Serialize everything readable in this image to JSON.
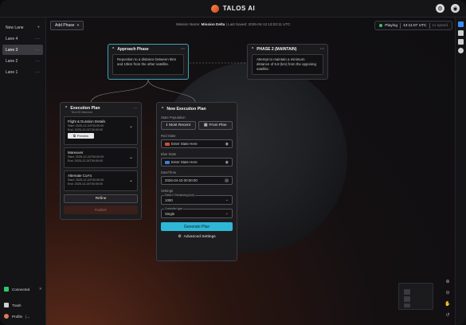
{
  "app": {
    "title": "TALOS AI"
  },
  "sidebar": {
    "new_lane": "New Lane",
    "new_lane_action": "+",
    "lanes": [
      {
        "label": "Lane 4",
        "action": "···"
      },
      {
        "label": "Lane 3",
        "action": "···"
      },
      {
        "label": "Lane 2",
        "action": "···"
      },
      {
        "label": "Lane 1",
        "action": "···"
      }
    ],
    "connected": "Connected",
    "connected_close": "✕",
    "trash": "Trash",
    "profile": "Profile",
    "profile_action": "|→"
  },
  "toolbar": {
    "add_phase": "Add Phase",
    "add_phase_icon": "+",
    "mission_label": "Mission Name:",
    "mission_name": "Mission Delta",
    "last_saved": "| Last Saved: 2026-04-13 13:03:11 UTC",
    "playing": "Playing",
    "clock": "13:11:07 UTC",
    "speed": "1x speed"
  },
  "phases": [
    {
      "title": "Approach Phase",
      "body": "Reposition to a distance between 5km and 10km from the other satellite."
    },
    {
      "title": "PHASE 2 (MAINTAIN)",
      "body": "Attempt to maintain a minimum distance of 5.8 (km) from the opposing satellite."
    }
  ],
  "execution_plan": {
    "title": "Execution Plan",
    "subtitle": "TALOS Mannon",
    "cards": [
      {
        "title": "Flight & Duration Details",
        "start": "Start: 2025-12-24T00:00:00",
        "end": "End: 2025-12-24T00:00:00",
        "preview": "Preview"
      },
      {
        "title": "Maneuver",
        "start": "Start: 2025-12-24T00:00:00",
        "end": "End: 2025-12-24T00:00:00"
      },
      {
        "title": "Alternate CoA's",
        "start": "Start: 2025-12-24T00:00:00",
        "end": "End: 2025-12-24T00:00:00"
      }
    ],
    "refine": "Refine",
    "publish": "Publish"
  },
  "new_plan": {
    "title": "New Execution Plan",
    "state_population_label": "State Population",
    "most_recent": "Most Recent",
    "from_plan": "From Plan",
    "red_state_label": "Red State",
    "red_state_placeholder": "Enter State Here",
    "blue_state_label": "Blue State",
    "blue_state_placeholder": "Enter State Here",
    "datetime_label": "Date/Time",
    "datetime_value": "2026-04-10 00:00:00",
    "settings_label": "Settings",
    "delta_v_label": "Delta-V Remaining (m/s)",
    "delta_v_value": "1000",
    "controller_label": "Controller type",
    "controller_value": "Single",
    "generate": "Generate Plan",
    "advanced": "Advanced Settings"
  },
  "colors": {
    "accent": "#2fb7d6",
    "playing": "#32c66b",
    "selected_border": "#3ca2b8"
  },
  "icons": {
    "zoom_in": "⊕",
    "zoom_out": "⊖",
    "pan": "✋",
    "reset": "↺"
  }
}
